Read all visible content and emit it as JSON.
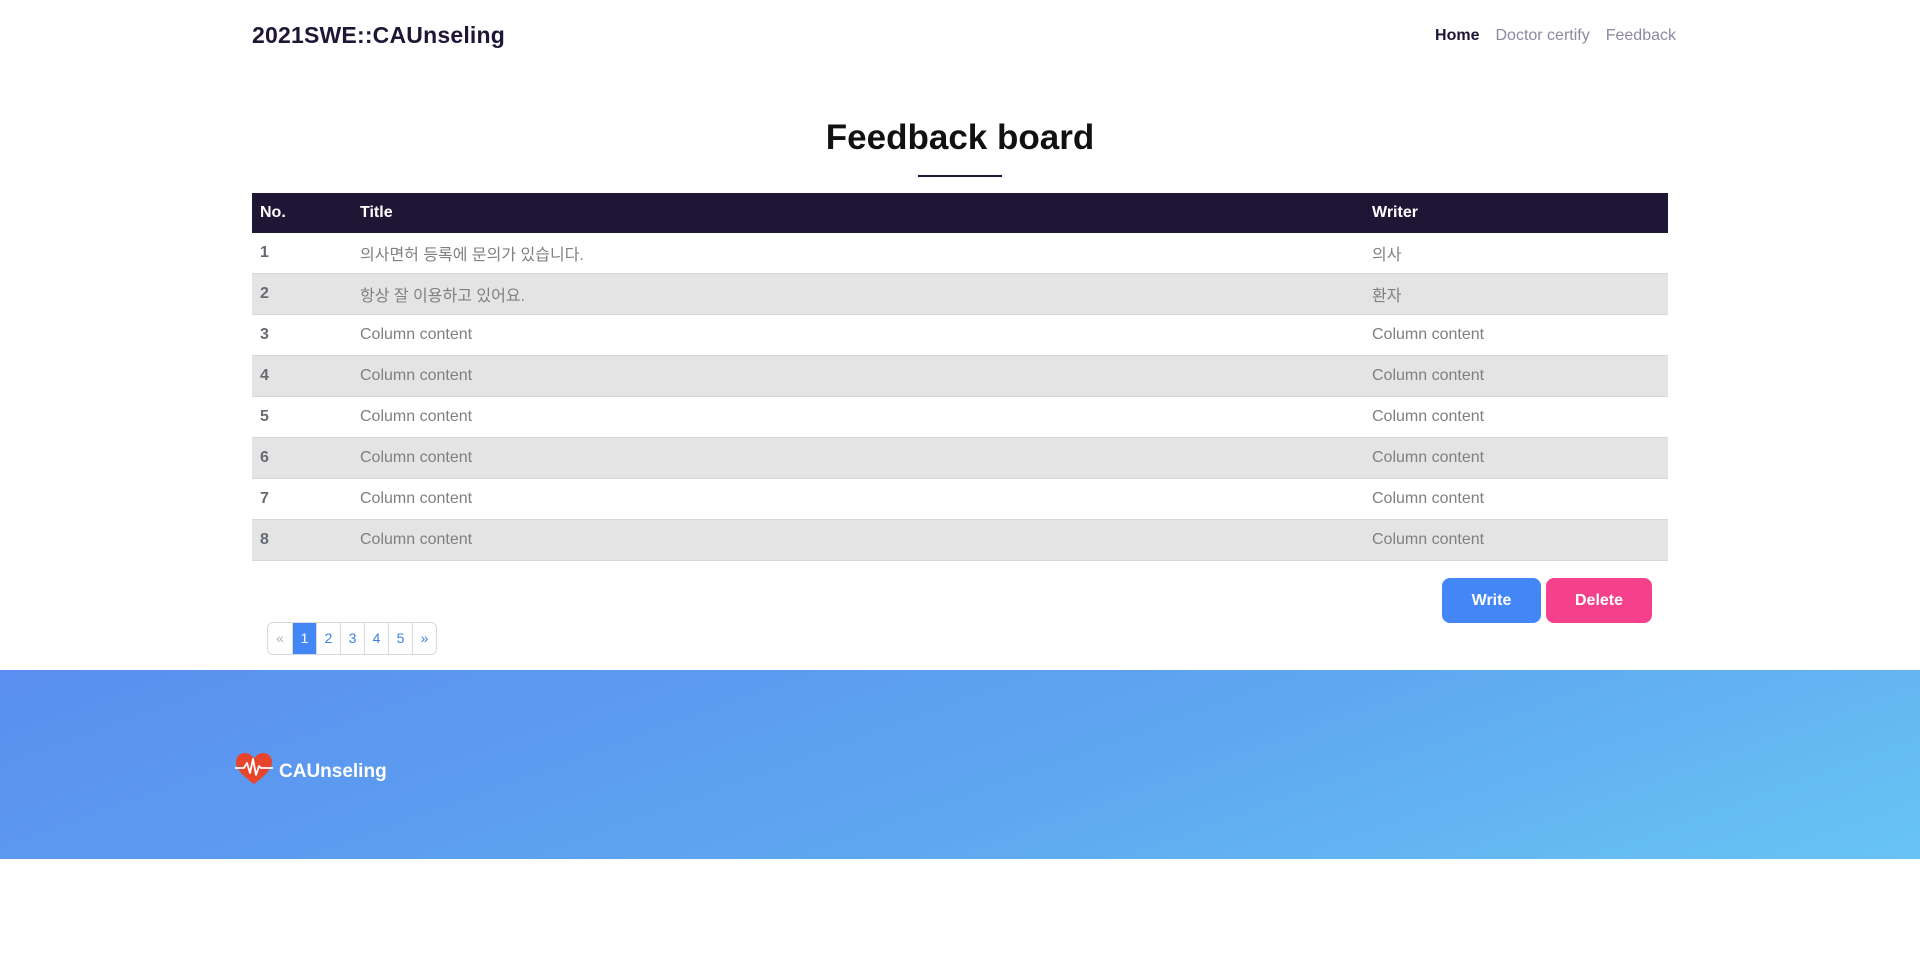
{
  "navbar": {
    "brand": "2021SWE::CAUnseling",
    "links": [
      {
        "label": "Home",
        "active": true
      },
      {
        "label": "Doctor certify",
        "active": false
      },
      {
        "label": "Feedback",
        "active": false
      }
    ]
  },
  "page": {
    "title": "Feedback board"
  },
  "table": {
    "headers": [
      "No.",
      "Title",
      "Writer"
    ],
    "rows": [
      [
        "1",
        "의사면허 등록에 문의가 있습니다.",
        "의사"
      ],
      [
        "2",
        "항상 잘 이용하고 있어요.",
        "환자"
      ],
      [
        "3",
        "Column content",
        "Column content"
      ],
      [
        "4",
        "Column content",
        "Column content"
      ],
      [
        "5",
        "Column content",
        "Column content"
      ],
      [
        "6",
        "Column content",
        "Column content"
      ],
      [
        "7",
        "Column content",
        "Column content"
      ],
      [
        "8",
        "Column content",
        "Column content"
      ]
    ]
  },
  "actions": {
    "write_label": "Write",
    "delete_label": "Delete"
  },
  "pagination": {
    "prev": "«",
    "pages": [
      "1",
      "2",
      "3",
      "4",
      "5"
    ],
    "next": "»",
    "current": "1"
  },
  "footer": {
    "brand": "CAUnseling",
    "logo_icon": "heart-pulse-icon"
  },
  "colors": {
    "dark": "#1f1535",
    "primary": "#4287f5",
    "danger": "#f5418b",
    "logo_red": "#e8452c"
  }
}
